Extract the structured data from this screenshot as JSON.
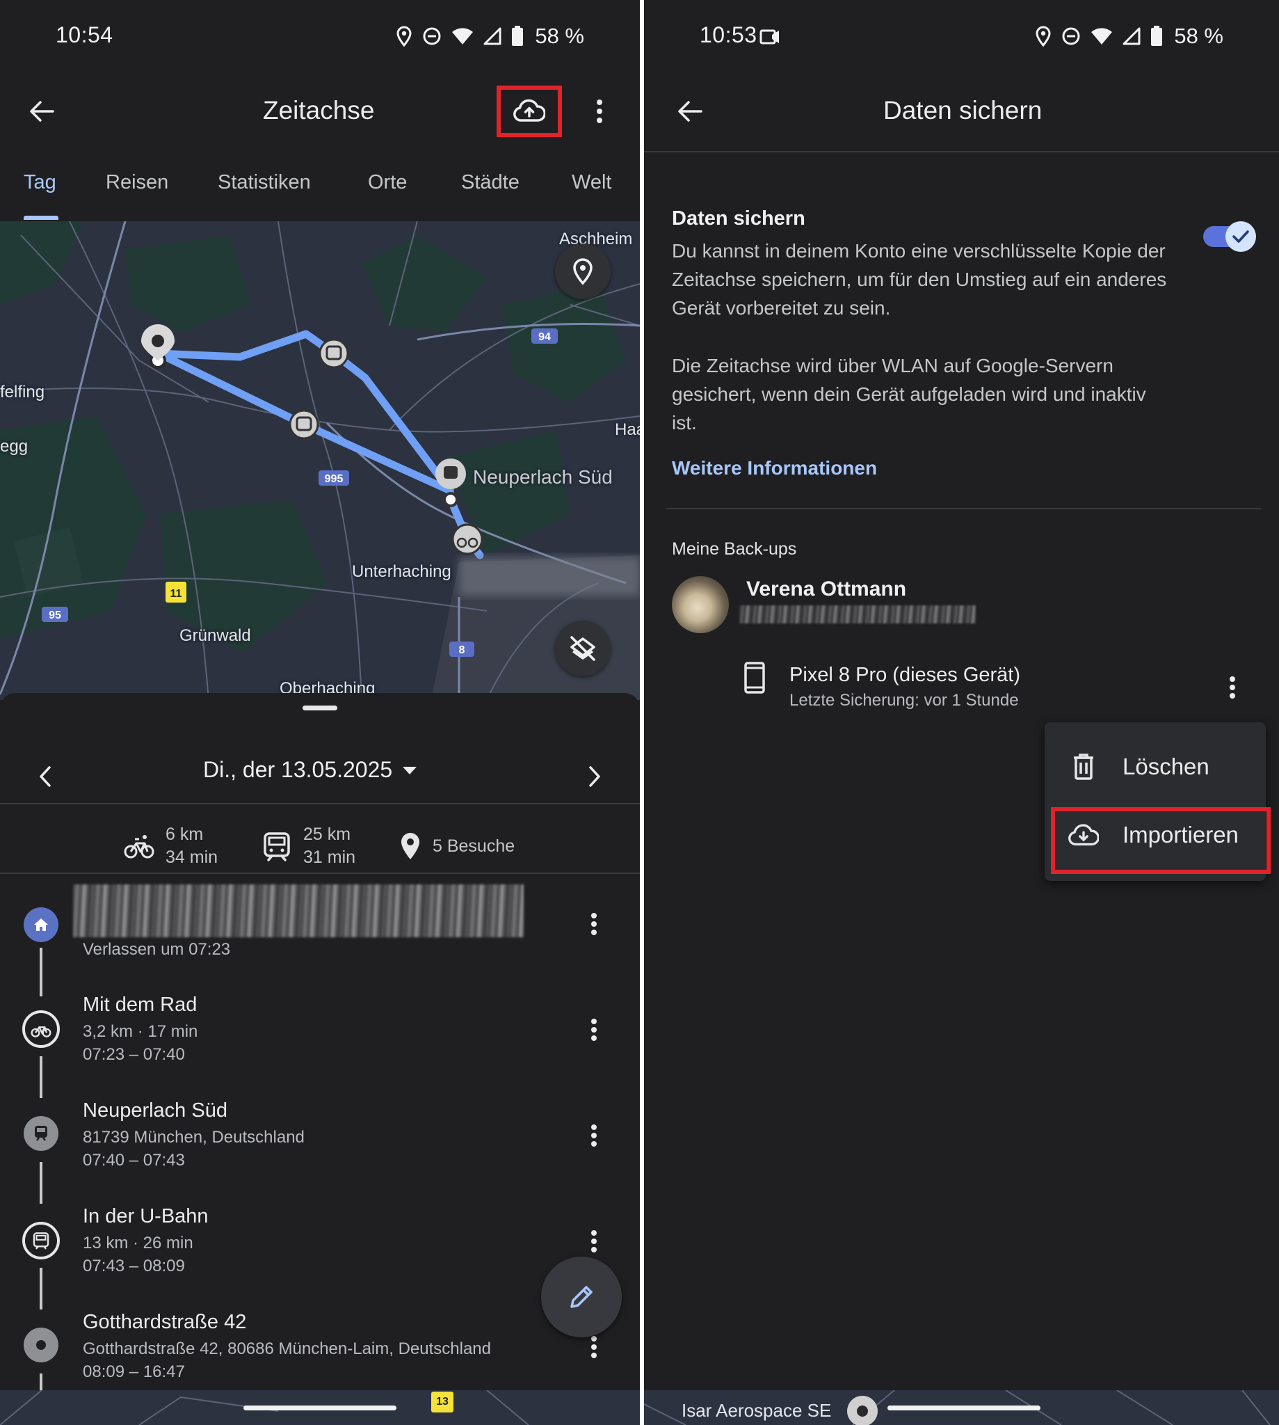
{
  "left_panel": {
    "status": {
      "time": "10:54",
      "battery": "58 %"
    },
    "appbar": {
      "title": "Zeitachse"
    },
    "tabs": [
      {
        "label": "Tag",
        "active": true
      },
      {
        "label": "Reisen"
      },
      {
        "label": "Statistiken"
      },
      {
        "label": "Orte"
      },
      {
        "label": "Städte"
      },
      {
        "label": "Welt"
      }
    ],
    "map": {
      "labels": {
        "aschheim": "Aschheim",
        "planegg_fragment": "felfing",
        "egg_fragment": "egg",
        "haar_fragment": "Haa",
        "neuperlach": "Neuperlach Süd",
        "unterhaching": "Unterhaching",
        "gruenwald": "Grünwald",
        "oberhaching": "Oberhaching"
      },
      "road_shields": {
        "a94": "94",
        "a995": "995",
        "a95": "95",
        "a11": "11",
        "a8": "8",
        "a13": "13"
      }
    },
    "date": {
      "label": "Di., der 13.05.2025"
    },
    "summary": {
      "bike": {
        "distance": "6 km",
        "duration": "34 min"
      },
      "transit": {
        "distance": "25 km",
        "duration": "31 min"
      },
      "visits": "5 Besuche"
    },
    "timeline": [
      {
        "type": "home",
        "title": "",
        "line1": "Verlassen um 07:23",
        "line2": ""
      },
      {
        "type": "bike",
        "title": "Mit dem Rad",
        "line1": "3,2 km · 17 min",
        "line2": "07:23 – 07:40"
      },
      {
        "type": "station",
        "title": "Neuperlach Süd",
        "line1": "81739 München, Deutschland",
        "line2": "07:40 – 07:43"
      },
      {
        "type": "subway",
        "title": "In der U-Bahn",
        "line1": "13 km · 26 min",
        "line2": "07:43 – 08:09"
      },
      {
        "type": "place",
        "title": "Gotthardstraße 42",
        "line1": "Gotthardstraße 42, 80686 München-Laim, Deutschland",
        "line2": "08:09 – 16:47"
      }
    ]
  },
  "right_panel": {
    "status": {
      "time": "10:53",
      "battery": "58 %"
    },
    "appbar": {
      "title": "Daten sichern"
    },
    "backup": {
      "title": "Daten sichern",
      "description1": "Du kannst in deinem Konto eine verschlüsselte Kopie der Zeitachse speichern, um für den Umstieg auf ein anderes Gerät vorbereitet zu sein.",
      "description2": "Die Zeitachse wird über WLAN auf Google-Servern gesichert, wenn dein Gerät aufgeladen wird und inaktiv ist.",
      "link": "Weitere Informationen",
      "enabled": true
    },
    "my_backups": {
      "header": "Meine Back-ups",
      "account_name": "Verena Ottmann",
      "device_name": "Pixel 8 Pro (dieses Gerät)",
      "device_last_backup": "Letzte Sicherung: vor 1 Stunde"
    },
    "menu": {
      "delete": "Löschen",
      "import": "Importieren"
    },
    "map_strip_label": "Isar Aerospace SE"
  },
  "colors": {
    "accent": "#a8c7fa",
    "highlight": "#e0232b",
    "route": "#6fa0f5",
    "toggle": "#5b72dc"
  }
}
